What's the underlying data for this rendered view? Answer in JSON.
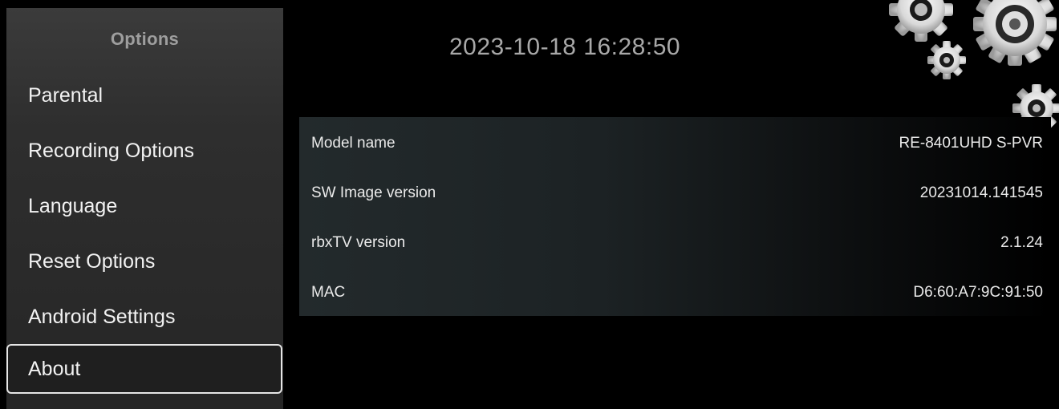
{
  "sidebar": {
    "title": "Options",
    "items": [
      {
        "label": "Parental",
        "selected": false
      },
      {
        "label": "Recording Options",
        "selected": false
      },
      {
        "label": "Language",
        "selected": false
      },
      {
        "label": "Reset Options",
        "selected": false
      },
      {
        "label": "Android Settings",
        "selected": false
      },
      {
        "label": "About",
        "selected": true
      }
    ]
  },
  "header": {
    "datetime": "2023-10-18 16:28:50"
  },
  "info": {
    "rows": [
      {
        "label": "Model name",
        "value": "RE-8401UHD S-PVR"
      },
      {
        "label": "SW Image version",
        "value": "20231014.141545"
      },
      {
        "label": "rbxTV version",
        "value": "2.1.24"
      },
      {
        "label": "MAC",
        "value": "D6:60:A7:9C:91:50"
      }
    ]
  },
  "decoration": {
    "icon": "gears-icon"
  },
  "colors": {
    "background": "#000000",
    "sidebar": "#2e2e2e",
    "selected_border": "#e6e6e6",
    "datetime": "#a8a8a8",
    "sidebar_title": "#9e9e9e"
  }
}
